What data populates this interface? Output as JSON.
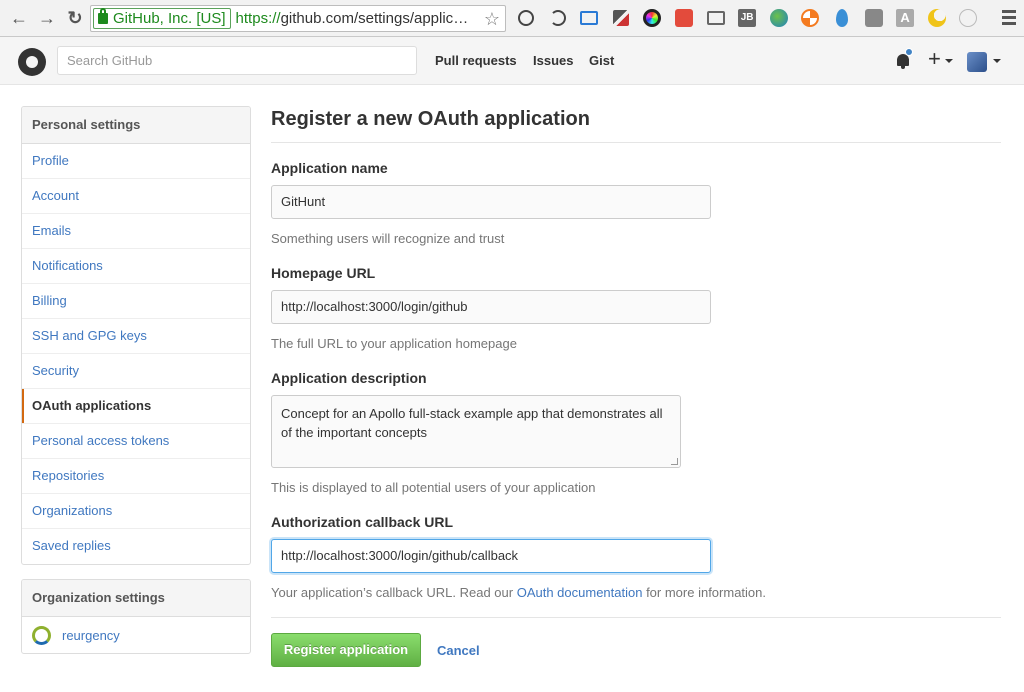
{
  "browser": {
    "cert_owner": "GitHub, Inc. [US]",
    "url_scheme": "https://",
    "url_rest": "github.com/settings/applicat...",
    "extension_icons": [
      "1password-icon",
      "sync-icon",
      "screenshot-icon",
      "eyedropper-icon",
      "color-wheel-icon",
      "shield-extension-icon",
      "cast-icon",
      "jb-icon",
      "globe-icon",
      "lifebuoy-icon",
      "drop-icon",
      "tool-icon",
      "font-icon",
      "moon-icon",
      "react-icon"
    ],
    "jb_label": "JB",
    "font_label": "A",
    "colors": {
      "secure_green": "#1e8a1e"
    }
  },
  "header": {
    "search_placeholder": "Search GitHub",
    "nav": [
      "Pull requests",
      "Issues",
      "Gist"
    ],
    "plus_label": "+"
  },
  "sidebar": {
    "personal_heading": "Personal settings",
    "items": [
      {
        "label": "Profile"
      },
      {
        "label": "Account"
      },
      {
        "label": "Emails"
      },
      {
        "label": "Notifications"
      },
      {
        "label": "Billing"
      },
      {
        "label": "SSH and GPG keys"
      },
      {
        "label": "Security"
      },
      {
        "label": "OAuth applications",
        "selected": true
      },
      {
        "label": "Personal access tokens"
      },
      {
        "label": "Repositories"
      },
      {
        "label": "Organizations"
      },
      {
        "label": "Saved replies"
      }
    ],
    "org_heading": "Organization settings",
    "org_name": "reurgency"
  },
  "form": {
    "title": "Register a new OAuth application",
    "app_name_label": "Application name",
    "app_name_value": "GitHunt",
    "app_name_note": "Something users will recognize and trust",
    "homepage_label": "Homepage URL",
    "homepage_value": "http://localhost:3000/login/github",
    "homepage_note": "The full URL to your application homepage",
    "description_label": "Application description",
    "description_value": "Concept for an Apollo full-stack example app that demonstrates all of the important concepts",
    "description_note": "This is displayed to all potential users of your application",
    "callback_label": "Authorization callback URL",
    "callback_value": "http://localhost:3000/login/github/callback",
    "callback_note_before": "Your application’s callback URL. Read our ",
    "callback_note_link": "OAuth documentation",
    "callback_note_after": " for more information.",
    "register_button": "Register application",
    "cancel_link": "Cancel"
  }
}
